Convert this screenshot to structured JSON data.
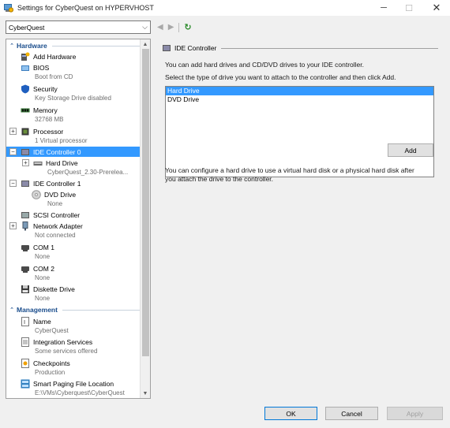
{
  "window": {
    "title": "Settings for CyberQuest on HYPERVHOST",
    "minimize": "─",
    "maximize": "☐",
    "close": "✕"
  },
  "vm_select": {
    "value": "CyberQuest",
    "arrow": "⌵"
  },
  "nav": {
    "back": "◀",
    "forward": "▶",
    "refresh": "↻"
  },
  "tree": {
    "hardware_section": "Hardware",
    "management_section": "Management",
    "items": [
      {
        "label": "Add Hardware",
        "sub": ""
      },
      {
        "label": "BIOS",
        "sub": "Boot from CD"
      },
      {
        "label": "Security",
        "sub": "Key Storage Drive disabled"
      },
      {
        "label": "Memory",
        "sub": "32768 MB"
      },
      {
        "label": "Processor",
        "sub": "1 Virtual processor"
      },
      {
        "label": "IDE Controller 0",
        "sub": ""
      },
      {
        "label": "Hard Drive",
        "sub": "CyberQuest_2.30-Prerelea..."
      },
      {
        "label": "IDE Controller 1",
        "sub": ""
      },
      {
        "label": "DVD Drive",
        "sub": "None"
      },
      {
        "label": "SCSI Controller",
        "sub": ""
      },
      {
        "label": "Network Adapter",
        "sub": "Not connected"
      },
      {
        "label": "COM 1",
        "sub": "None"
      },
      {
        "label": "COM 2",
        "sub": "None"
      },
      {
        "label": "Diskette Drive",
        "sub": "None"
      },
      {
        "label": "Name",
        "sub": "CyberQuest"
      },
      {
        "label": "Integration Services",
        "sub": "Some services offered"
      },
      {
        "label": "Checkpoints",
        "sub": "Production"
      },
      {
        "label": "Smart Paging File Location",
        "sub": "E:\\VMs\\Cyberquest\\CyberQuest"
      }
    ],
    "expander_plus": "+",
    "expander_minus": "−",
    "collapse_chevron": "⌃"
  },
  "panel": {
    "header": "IDE Controller",
    "intro": "You can add hard drives and CD/DVD drives to your IDE controller.",
    "instruction": "Select the type of drive you want to attach to the controller and then click Add.",
    "options": [
      "Hard Drive",
      "DVD Drive"
    ],
    "add_label": "Add",
    "note_line1": "You can configure a hard drive to use a virtual hard disk or a physical hard disk after",
    "note_line2": "you attach the drive to the controller."
  },
  "buttons": {
    "ok": "OK",
    "cancel": "Cancel",
    "apply": "Apply"
  },
  "colors": {
    "selection": "#3399ff",
    "section_header": "#1a4d8c",
    "refresh": "#2a8a2a"
  }
}
